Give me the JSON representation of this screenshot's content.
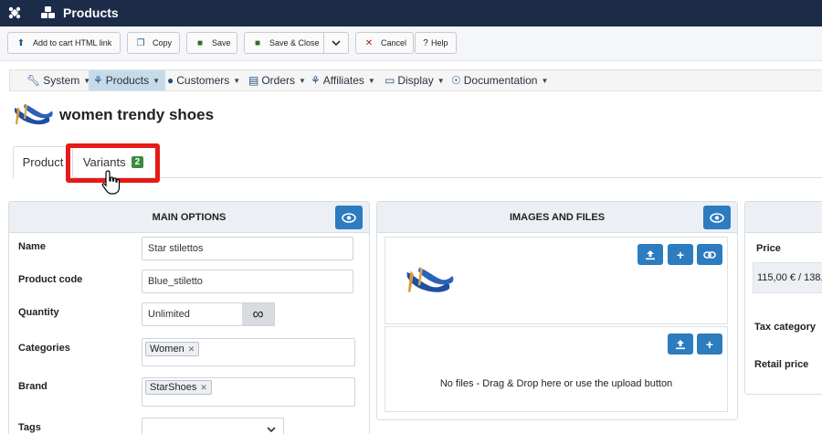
{
  "header": {
    "title": "Products"
  },
  "toolbar": {
    "add_to_cart": "Add to cart HTML link",
    "copy": "Copy",
    "save": "Save",
    "save_close": "Save & Close",
    "cancel": "Cancel",
    "help": "Help"
  },
  "nav": {
    "items": [
      {
        "label": "System"
      },
      {
        "label": "Products"
      },
      {
        "label": "Customers"
      },
      {
        "label": "Orders"
      },
      {
        "label": "Affiliates"
      },
      {
        "label": "Display"
      },
      {
        "label": "Documentation"
      }
    ]
  },
  "product": {
    "title": "women trendy shoes"
  },
  "tabs": {
    "product": "Product",
    "variants": "Variants",
    "variants_count": "2"
  },
  "main_options": {
    "title": "MAIN OPTIONS",
    "name_label": "Name",
    "name_value": "Star stilettos",
    "code_label": "Product code",
    "code_value": "Blue_stiletto",
    "quantity_label": "Quantity",
    "quantity_value": "Unlimited",
    "infinity_symbol": "∞",
    "categories_label": "Categories",
    "category_chip": "Women",
    "brand_label": "Brand",
    "brand_chip": "StarShoes",
    "tags_label": "Tags"
  },
  "images": {
    "title": "IMAGES AND FILES",
    "no_files": "No files - Drag & Drop here or use the upload button"
  },
  "price": {
    "price_label": "Price",
    "price_value": "115,00 € / 138,",
    "tax_label": "Tax category",
    "retail_label": "Retail price"
  },
  "colors": {
    "header_bg": "#1c2b48",
    "accent_blue": "#2c7cbf",
    "badge_green": "#3c8a3e",
    "highlight_red": "#e41b17",
    "nav_active": "#c6dbe9"
  }
}
